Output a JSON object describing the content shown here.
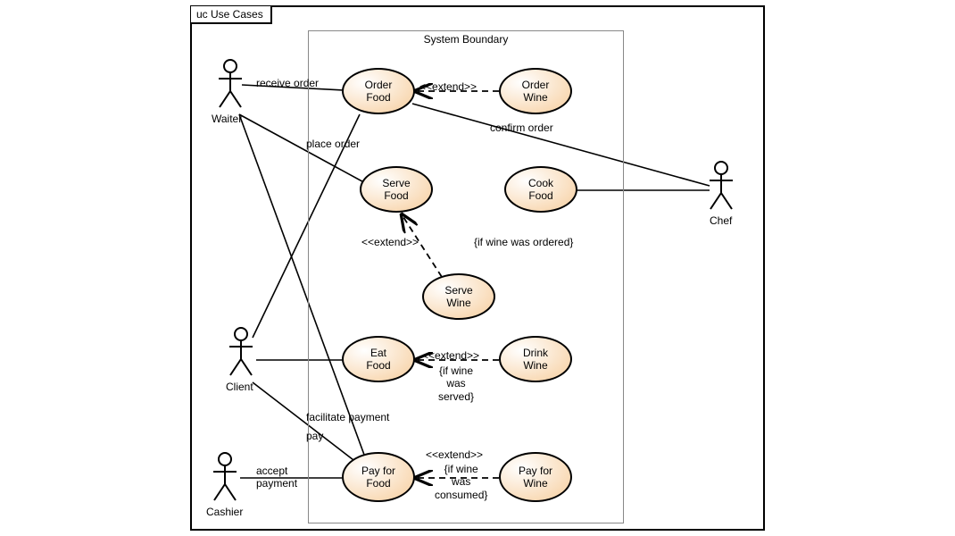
{
  "frame": {
    "title": "uc Use Cases"
  },
  "boundary": {
    "label": "System Boundary"
  },
  "actors": {
    "waiter": "Waiter",
    "client": "Client",
    "cashier": "Cashier",
    "chef": "Chef"
  },
  "usecases": {
    "order_food": "Order\nFood",
    "order_wine": "Order\nWine",
    "serve_food": "Serve\nFood",
    "cook_food": "Cook\nFood",
    "serve_wine": "Serve\nWine",
    "eat_food": "Eat\nFood",
    "drink_wine": "Drink\nWine",
    "pay_food": "Pay for\nFood",
    "pay_wine": "Pay for\nWine"
  },
  "labels": {
    "receive_order": "receive order",
    "extend1": "<<extend>>",
    "confirm_order": "confirm order",
    "place_order": "place order",
    "extend2": "<<extend>>",
    "guard_wine_ordered": "{if wine was ordered}",
    "extend3": "<<extend>>",
    "guard_wine_served": "{if wine\nwas\nserved}",
    "facilitate_payment": "facilitate payment",
    "pay": "pay",
    "accept_payment": "accept\npayment",
    "extend4": "<<extend>>",
    "guard_wine_consumed": "{if wine\nwas\nconsumed}"
  }
}
